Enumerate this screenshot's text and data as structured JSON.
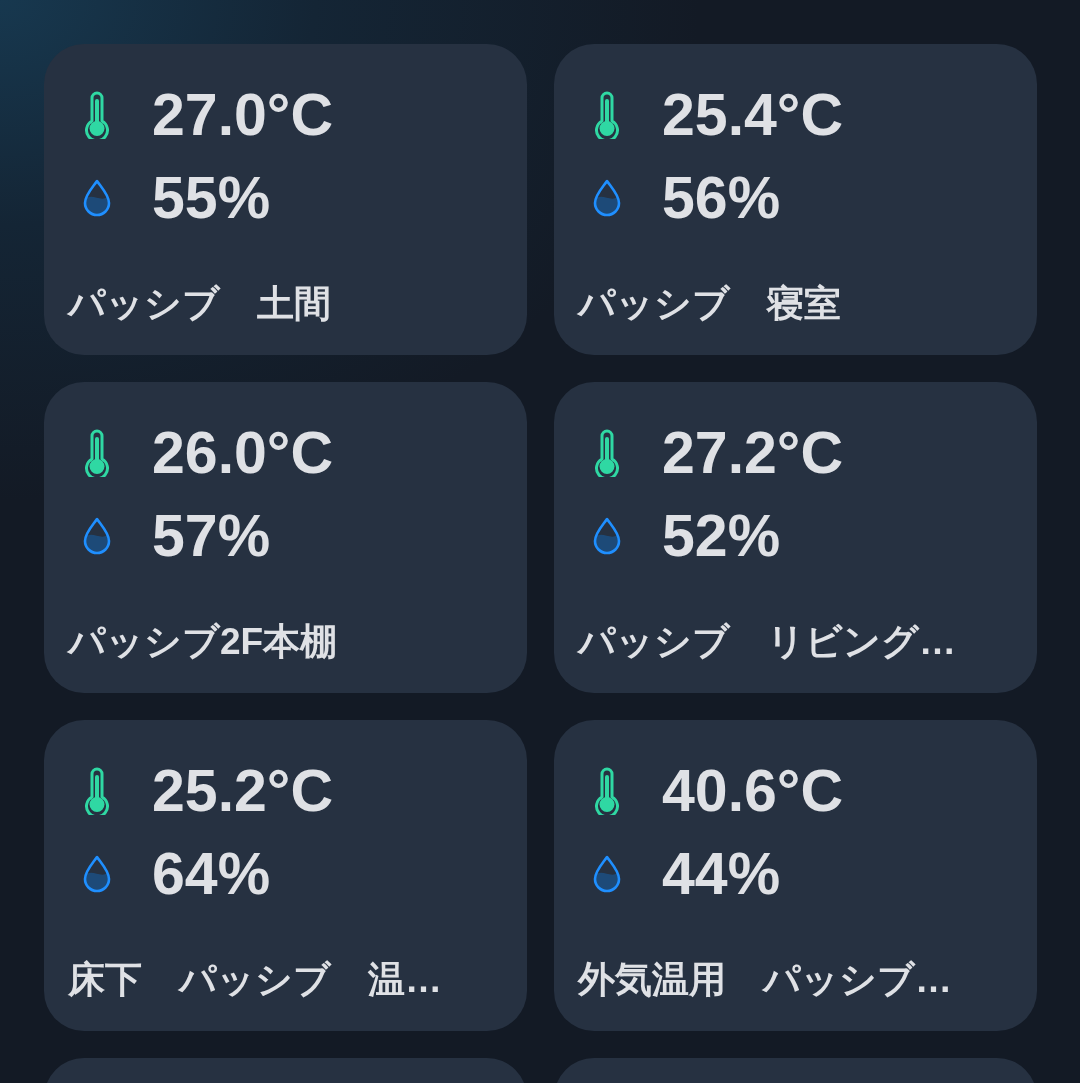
{
  "cards": [
    {
      "kind": "sensor",
      "temperature": "27.0°C",
      "humidity": "55%",
      "name": "パッシブ　土間"
    },
    {
      "kind": "sensor",
      "temperature": "25.4°C",
      "humidity": "56%",
      "name": "パッシブ　寝室"
    },
    {
      "kind": "sensor",
      "temperature": "26.0°C",
      "humidity": "57%",
      "name": "パッシブ2F本棚"
    },
    {
      "kind": "sensor",
      "temperature": "27.2°C",
      "humidity": "52%",
      "name": "パッシブ　リビング…"
    },
    {
      "kind": "sensor",
      "temperature": "25.2°C",
      "humidity": "64%",
      "name": "床下　パッシブ　温…"
    },
    {
      "kind": "sensor",
      "temperature": "40.6°C",
      "humidity": "44%",
      "name": "外気温用　パッシブ…"
    },
    {
      "kind": "cut_off"
    },
    {
      "kind": "cut_off"
    }
  ]
}
